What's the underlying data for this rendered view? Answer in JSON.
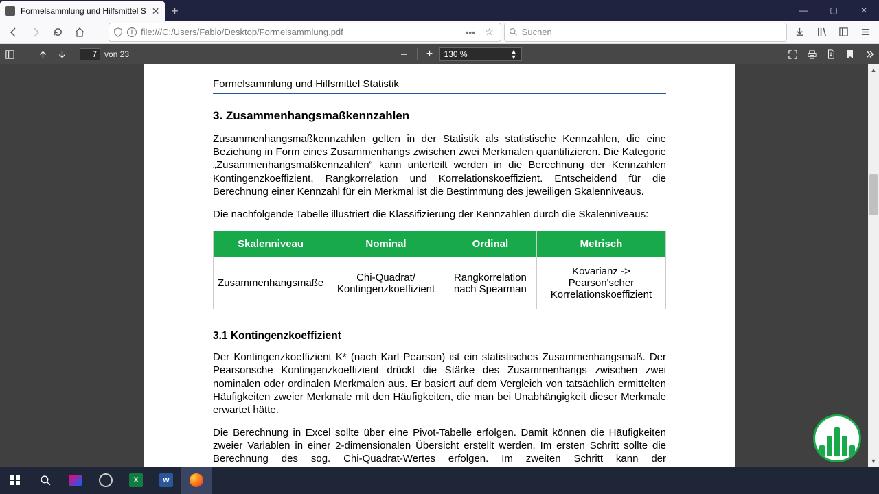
{
  "window": {
    "tab_title": "Formelsammlung und Hilfsmittel S",
    "min_label": "—",
    "max_label": "▢",
    "close_label": "✕"
  },
  "nav": {
    "url": "file:///C:/Users/Fabio/Desktop/Formelsammlung.pdf",
    "dots": "•••",
    "star": "☆",
    "search_icon": "Q",
    "search_placeholder": "Suchen"
  },
  "navicons": {
    "download": "⭳",
    "library": "lll\\",
    "pocket": "▣",
    "menu": "≡"
  },
  "pdfbar": {
    "page": "7",
    "page_of": "von 23",
    "zoom": "130 %"
  },
  "doc": {
    "header": "Formelsammlung und Hilfsmittel Statistik",
    "sec_title": "3. Zusammenhangsmaßkennzahlen",
    "p1": "Zusammenhangsmaßkennzahlen gelten in der Statistik als statistische Kennzahlen, die eine Beziehung in Form eines Zusammenhangs zwischen zwei Merkmalen quantifizieren. Die Kategorie „Zusammenhangsmaßkennzahlen“ kann unterteilt werden in die Berechnung der Kennzahlen Kontingenzkoeffizient, Rangkorrelation und Korrelationskoeffizient. Entscheidend für die Berechnung einer Kennzahl für ein Merkmal ist die Bestimmung des jeweiligen Skalenniveaus.",
    "p2": "Die nachfolgende Tabelle illustriert die Klassifizierung der Kennzahlen durch die Skalenniveaus:",
    "table": {
      "h1": "Skalenniveau",
      "h2": "Nominal",
      "h3": "Ordinal",
      "h4": "Metrisch",
      "r1c1": "Zusammenhangsmaße",
      "r1c2": "Chi-Quadrat/ Kontingenzkoeffizient",
      "r1c3": "Rangkorrelation nach Spearman",
      "r1c4": "Kovarianz -> Pearson'scher Korrelationskoeffizient"
    },
    "subsec": "3.1 Kontingenzkoeffizient",
    "p3": "Der Kontingenzkoeffizient K* (nach Karl Pearson) ist ein statistisches Zusammenhangsmaß. Der Pearsonsche Kontingenzkoeffizient drückt die Stärke des Zusammenhangs zwischen zwei  nominalen oder ordinalen Merkmalen aus. Er basiert auf dem Vergleich von tatsächlich ermittelten Häufigkeiten zweier Merkmale mit den Häufigkeiten, die man bei Unabhängigkeit dieser Merkmale erwartet hätte.",
    "p4": "Die Berechnung in Excel sollte über eine Pivot-Tabelle erfolgen. Damit können die Häufigkeiten zweier Variablen in einer 2-dimensionalen Übersicht erstellt werden. Im ersten Schritt sollte die Berechnung des sog. Chi-Quadrat-Wertes erfolgen. Im zweiten Schritt kann der Kontingenzkoeffizient K* final berechnet und interpretiert werden."
  }
}
